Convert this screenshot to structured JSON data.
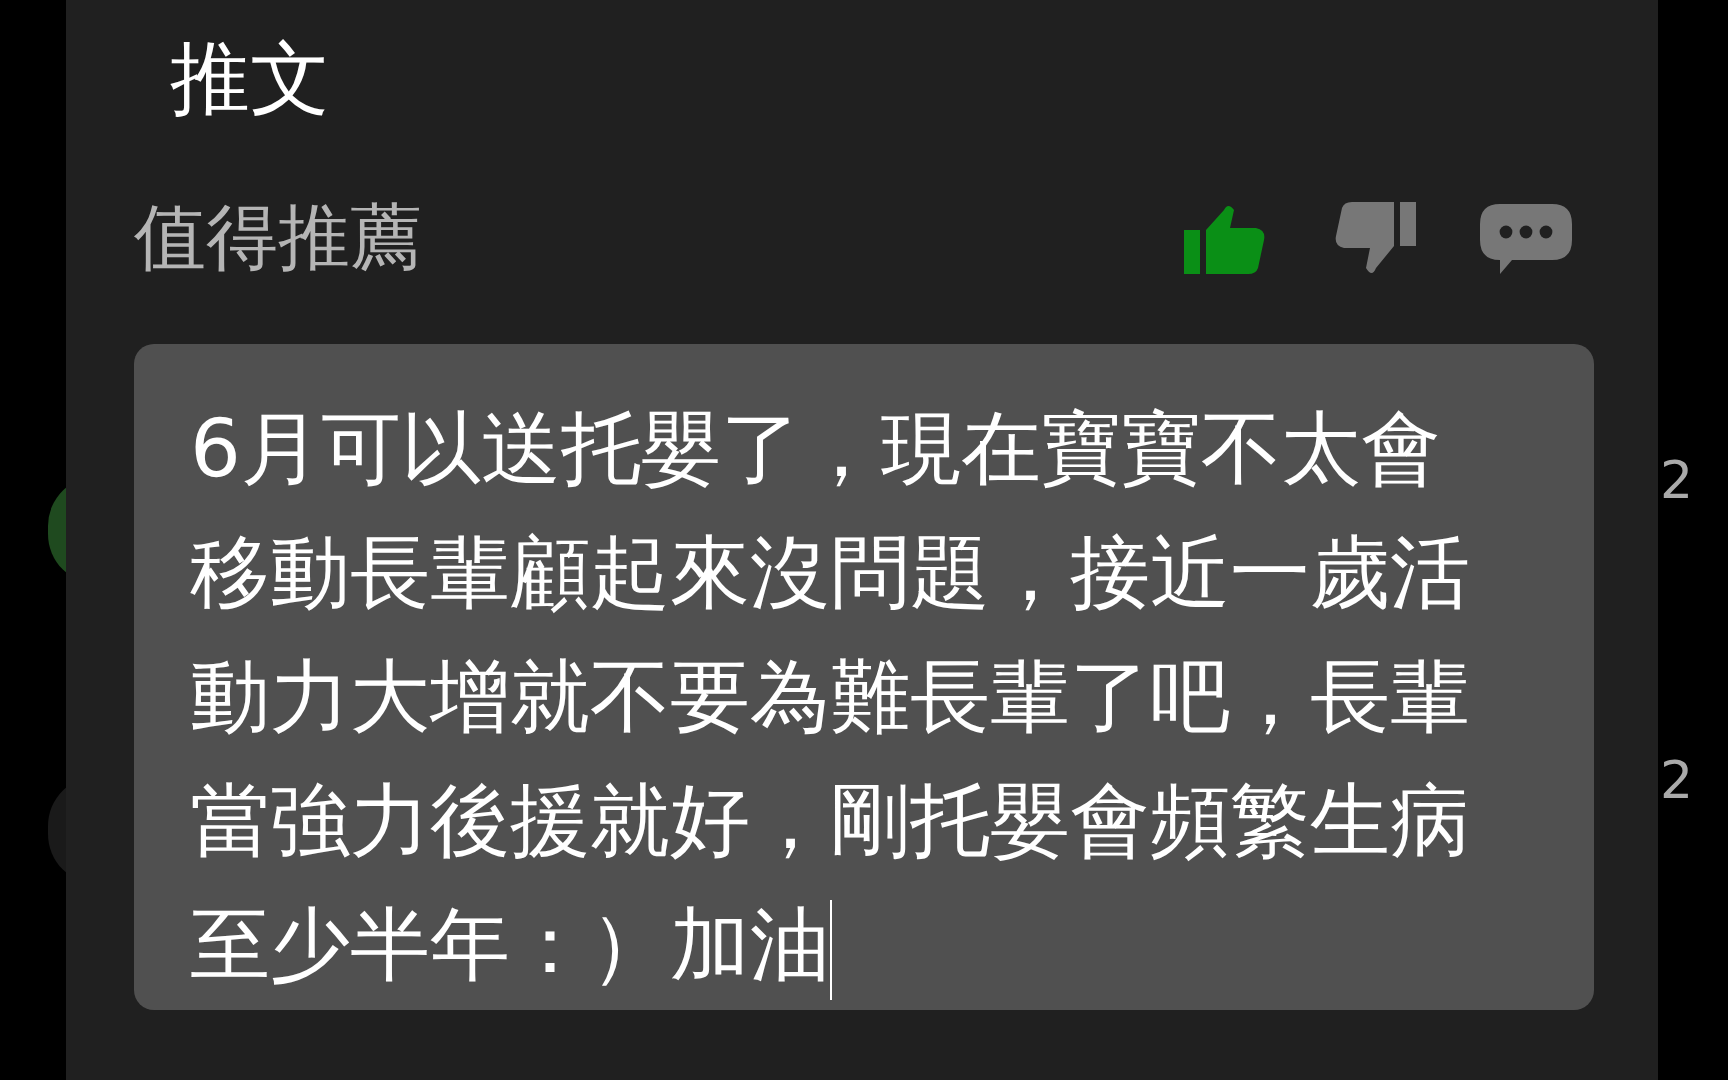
{
  "dialog": {
    "title": "推文",
    "rating_label": "值得推薦",
    "votes": [
      {
        "kind": "up",
        "selected": true
      },
      {
        "kind": "down",
        "selected": false
      },
      {
        "kind": "comment",
        "selected": false
      }
    ],
    "comment": {
      "value": "6月可以送托嬰了，現在寶寶不太會移動長輩顧起來沒問題，接近一歲活動力大增就不要為難長輩了吧，長輩當強力後援就好，剛托嬰會頻繁生病至少半年：）加油"
    }
  },
  "background": {
    "counts": [
      "2",
      "2"
    ]
  }
}
